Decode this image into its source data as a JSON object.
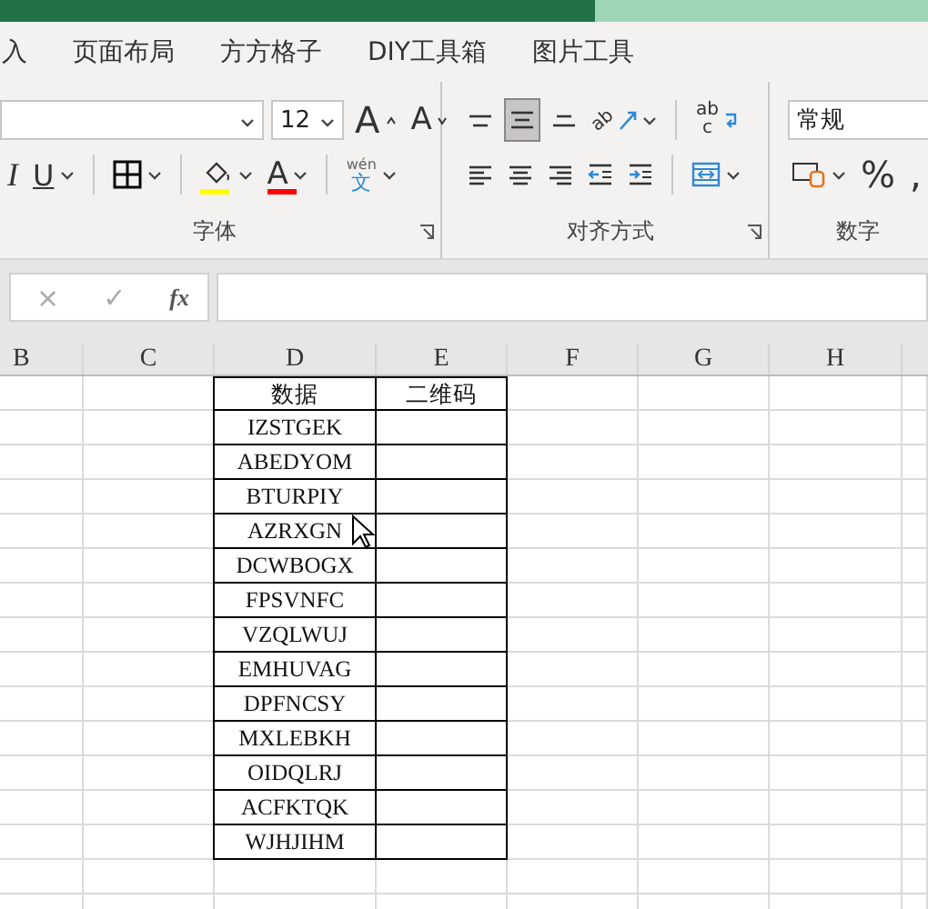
{
  "tabs": [
    {
      "label": "入"
    },
    {
      "label": "页面布局"
    },
    {
      "label": "方方格子"
    },
    {
      "label": "DIY工具箱"
    },
    {
      "label": "图片工具"
    }
  ],
  "ribbon": {
    "groups": [
      {
        "kind": "font",
        "label": "字体",
        "top": [
          {
            "kind": "font_name"
          },
          {
            "kind": "font_size",
            "value": "12"
          },
          {
            "kind": "grow",
            "glyph": "A"
          },
          {
            "kind": "shrink",
            "glyph": "A"
          }
        ],
        "bottom": [
          {
            "kind": "italic",
            "glyph": "I"
          },
          {
            "kind": "underline",
            "glyph": "U"
          },
          {
            "kind": "divider"
          },
          {
            "kind": "borders"
          },
          {
            "kind": "divider"
          },
          {
            "kind": "fill",
            "color": "#ffff00"
          },
          {
            "kind": "fontcolor",
            "glyph": "A",
            "color": "#ff0000"
          },
          {
            "kind": "divider"
          },
          {
            "kind": "phonetic",
            "top": "wén",
            "bottom": "文"
          }
        ]
      },
      {
        "kind": "alignment",
        "label": "对齐方式",
        "top": [
          {
            "kind": "valign_top",
            "selected": false
          },
          {
            "kind": "valign_middle",
            "selected": true
          },
          {
            "kind": "valign_bottom",
            "selected": false
          },
          {
            "kind": "orientation",
            "top": "ab"
          },
          {
            "kind": "divider"
          },
          {
            "kind": "wrap",
            "top": "ab",
            "bottom": "c"
          }
        ],
        "bottom": [
          {
            "kind": "align_left"
          },
          {
            "kind": "align_center"
          },
          {
            "kind": "align_right"
          },
          {
            "kind": "indent_less"
          },
          {
            "kind": "indent_more"
          },
          {
            "kind": "divider"
          },
          {
            "kind": "merge"
          }
        ]
      },
      {
        "kind": "number",
        "label": "数字",
        "top": [
          {
            "kind": "number_format",
            "value": "常规"
          }
        ],
        "bottom": [
          {
            "kind": "accounting"
          },
          {
            "kind": "glyph",
            "glyph": "%"
          },
          {
            "kind": "glyph",
            "glyph": ","
          }
        ]
      }
    ]
  },
  "formula_bar": {
    "cancel": "×",
    "enter": "✓",
    "function": "fx"
  },
  "sheet": {
    "columns": [
      {
        "label": "B"
      },
      {
        "label": "C"
      },
      {
        "label": "D"
      },
      {
        "label": "E"
      },
      {
        "label": "F"
      },
      {
        "label": "G"
      },
      {
        "label": "H"
      }
    ],
    "header_row": [
      "数据",
      "二维码"
    ],
    "rows": [
      {
        "data": "IZSTGEK"
      },
      {
        "data": "ABEDYOM"
      },
      {
        "data": "BTURPIY"
      },
      {
        "data": "AZRXGN"
      },
      {
        "data": "DCWBOGX"
      },
      {
        "data": "FPSVNFC"
      },
      {
        "data": "VZQLWUJ"
      },
      {
        "data": "EMHUVAG"
      },
      {
        "data": "DPFNCSY"
      },
      {
        "data": "MXLEBKH"
      },
      {
        "data": "OIDQLRJ"
      },
      {
        "data": "ACFKTQK"
      },
      {
        "data": "WJHJIHM"
      }
    ]
  }
}
